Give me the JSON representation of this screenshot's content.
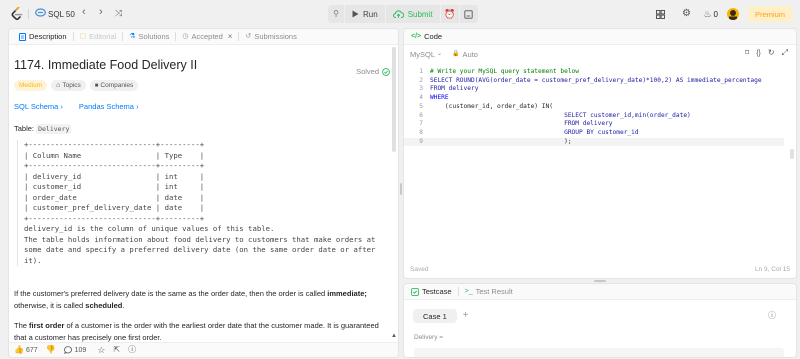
{
  "topnav": {
    "study_set": "SQL 50",
    "run": "Run",
    "submit": "Submit",
    "coins": "0",
    "premium": "Premium"
  },
  "left_tabs": [
    {
      "label": "Description",
      "icon": "document-icon",
      "active": true
    },
    {
      "label": "Editorial",
      "icon": "book-icon",
      "active": false
    },
    {
      "label": "Solutions",
      "icon": "flask-icon",
      "active": false
    },
    {
      "label": "Accepted",
      "icon": "clock-icon",
      "active": false
    },
    {
      "label": "Submissions",
      "icon": "history-icon",
      "active": false
    }
  ],
  "problem": {
    "title": "1174. Immediate Food Delivery II",
    "status": "Solved",
    "difficulty": "Medium",
    "topics": "Topics",
    "companies": "Companies",
    "sql_schema": "SQL Schema",
    "pandas_schema": "Pandas Schema",
    "table_label": "Table:",
    "table_name": "Delivery",
    "schema_text": "+-----------------------------+---------+\n| Column Name                 | Type    |\n+-----------------------------+---------+\n| delivery_id                 | int     |\n| customer_id                 | int     |\n| order_date                  | date    |\n| customer_pref_delivery_date | date    |\n+-----------------------------+---------+",
    "schema_note": "delivery_id is the column of unique values of this table.\nThe table holds information about food delivery to customers that make orders at\nsome date and specify a preferred delivery date (on the same order date or after\nit).",
    "para1_a": "If the customer's preferred delivery date is the same as the order date, then the order is called ",
    "para1_b": "immediate;",
    "para1_c": " otherwise, it is called ",
    "para1_d": "scheduled",
    "para1_e": ".",
    "para2_a": "The ",
    "para2_b": "first order",
    "para2_c": " of a customer is the order with the earliest order date that the customer made. It is guaranteed",
    "para2_d": "that a customer has precisely one first order."
  },
  "left_footer": {
    "likes": "677",
    "comments": "109"
  },
  "code_panel": {
    "tab": "Code",
    "language": "MySQL",
    "mode": "Auto",
    "saved": "Saved",
    "cursor": "Ln 9, Col 15",
    "lines": [
      "# Write your MySQL query statement below",
      "SELECT ROUND(AVG(order_date = customer_pref_delivery_date)*100,2) AS immediate_percentage",
      "FROM delivery",
      "WHERE",
      "    (customer_id, order_date) IN(",
      "                                    SELECT customer_id,min(order_date)",
      "                                    FROM delivery",
      "                                    GROUP BY customer_id",
      "                                    );"
    ]
  },
  "test_panel": {
    "testcase": "Testcase",
    "test_result": "Test Result",
    "case": "Case 1",
    "field": "Delivery ="
  }
}
